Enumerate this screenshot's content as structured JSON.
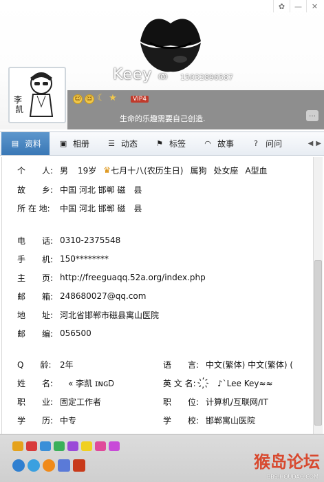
{
  "window": {
    "controls": [
      "skin-icon",
      "minimize-icon",
      "close-icon"
    ]
  },
  "profile": {
    "name": "Keey",
    "gender_glyph": "ത",
    "qq_number": "15032896587",
    "signature": "生命的乐趣需要自己创造.",
    "vip_label": "VIP4"
  },
  "tabs": [
    {
      "label": "资料",
      "icon": "profile-card-icon"
    },
    {
      "label": "相册",
      "icon": "photo-icon"
    },
    {
      "label": "动态",
      "icon": "feed-icon"
    },
    {
      "label": "标签",
      "icon": "bookmark-icon"
    },
    {
      "label": "故事",
      "icon": "story-icon"
    },
    {
      "label": "问问",
      "icon": "question-icon"
    }
  ],
  "info": {
    "person_label": "个　　人:",
    "gender": "男",
    "age": "19岁",
    "birthday": "七月十八(农历生日)",
    "zodiac": "属狗",
    "star": "处女座",
    "blood": "A型血",
    "hometown_label": "故　　乡:",
    "hometown": "中国 河北 邯郸 磁　县",
    "location_label": "所 在 地:",
    "location": "中国 河北 邯郸 磁　县",
    "phone_label": "电　　话:",
    "phone": "0310-2375548",
    "mobile_label": "手　　机:",
    "mobile": "150********",
    "homepage_label": "主　　页:",
    "homepage": "http://freeguaqq.52a.org/index.php",
    "email_label": "邮　　箱:",
    "email": "248680027@qq.com",
    "address_label": "地　　址:",
    "address": "河北省邯郸市磁县寓山医院",
    "zip_label": "邮　　编:",
    "zip": "056500",
    "qage_label": "Q　　龄:",
    "qage": "2年",
    "lang_label": "语　　言:",
    "lang": "中文(繁体) 中文(繁体) (",
    "realname_label": "姓　　名:",
    "realname": "« 李凯 ɪɴɢᎠ",
    "engname_label": "英 文 名:",
    "engname": "҉　♪`Lee Key≈≈",
    "job_label": "职　　业:",
    "job": "固定工作者",
    "position_label": "职　　位:",
    "position": "计算机/互联网/IT",
    "edu_label": "学　　历:",
    "edu": "中专",
    "school_label": "学　　校:",
    "school": "邯郸寓山医院"
  },
  "watermark": {
    "title": "猴岛论坛",
    "url": "BBS.HOUDAO.COM"
  },
  "colors": {
    "tab_active": "#4a87c2",
    "graybar": "#8e8e8e",
    "watermark": "#d93a1d"
  }
}
